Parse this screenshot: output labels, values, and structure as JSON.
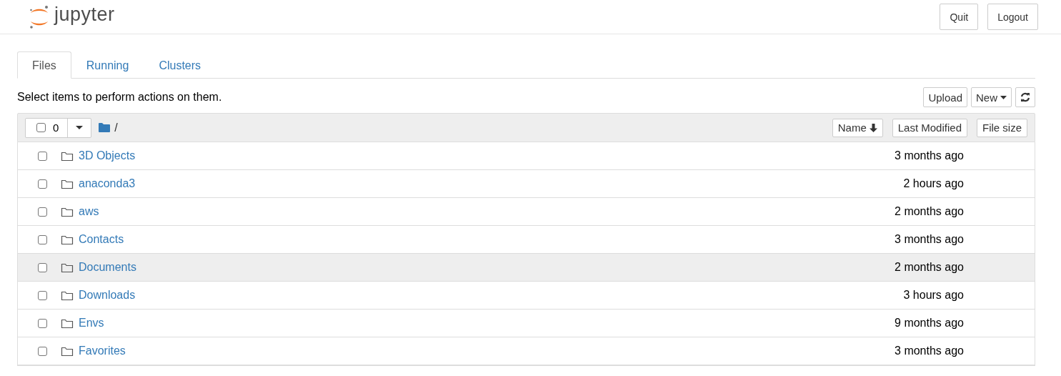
{
  "header": {
    "logo_text": "jupyter",
    "buttons": [
      "Quit",
      "Logout"
    ]
  },
  "tabs": [
    {
      "label": "Files",
      "selected": true
    },
    {
      "label": "Running",
      "selected": false
    },
    {
      "label": "Clusters",
      "selected": false
    }
  ],
  "toolbar": {
    "hint": "Select items to perform actions on them.",
    "buttons": [
      {
        "kind": "text",
        "label": "Upload"
      },
      {
        "kind": "dropdown",
        "label": "New"
      },
      {
        "kind": "refresh"
      }
    ]
  },
  "list_header": {
    "selected_count": "0",
    "checked": false,
    "path": "/",
    "sort_buttons": [
      {
        "label": "Name",
        "sorted": true
      },
      {
        "label": "Last Modified",
        "sorted": false
      },
      {
        "label": "File size",
        "sorted": false
      }
    ]
  },
  "items": [
    {
      "name": "3D Objects",
      "modified": "3 months ago",
      "checked": false,
      "highlighted": false
    },
    {
      "name": "anaconda3",
      "modified": "2 hours ago",
      "checked": false,
      "highlighted": false
    },
    {
      "name": "aws",
      "modified": "2 months ago",
      "checked": false,
      "highlighted": false
    },
    {
      "name": "Contacts",
      "modified": "3 months ago",
      "checked": false,
      "highlighted": false
    },
    {
      "name": "Documents",
      "modified": "2 months ago",
      "checked": false,
      "highlighted": true
    },
    {
      "name": "Downloads",
      "modified": "3 hours ago",
      "checked": false,
      "highlighted": false
    },
    {
      "name": "Envs",
      "modified": "9 months ago",
      "checked": false,
      "highlighted": false
    },
    {
      "name": "Favorites",
      "modified": "3 months ago",
      "checked": false,
      "highlighted": false
    }
  ]
}
